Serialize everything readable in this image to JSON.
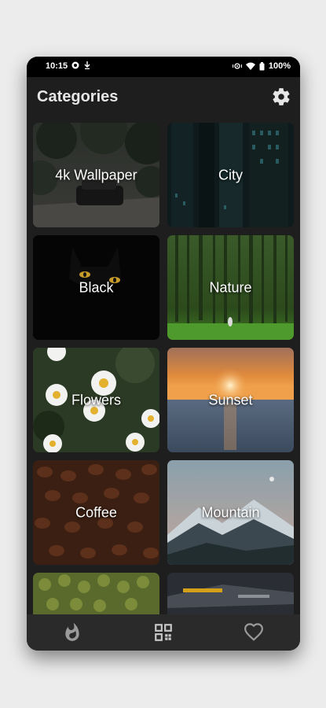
{
  "status": {
    "time": "10:15",
    "battery": "100%"
  },
  "header": {
    "title": "Categories"
  },
  "categories": [
    {
      "label": "4k Wallpaper"
    },
    {
      "label": "City"
    },
    {
      "label": "Black"
    },
    {
      "label": "Nature"
    },
    {
      "label": "Flowers"
    },
    {
      "label": "Sunset"
    },
    {
      "label": "Coffee"
    },
    {
      "label": "Mountain"
    },
    {
      "label": ""
    },
    {
      "label": ""
    }
  ],
  "nav": {
    "items": [
      "trending",
      "categories",
      "favorites"
    ]
  },
  "colors": {
    "background": "#1e1e1e",
    "nav": "#2a2a2a",
    "statusbar": "#000000",
    "title": "#e6e6e6"
  }
}
